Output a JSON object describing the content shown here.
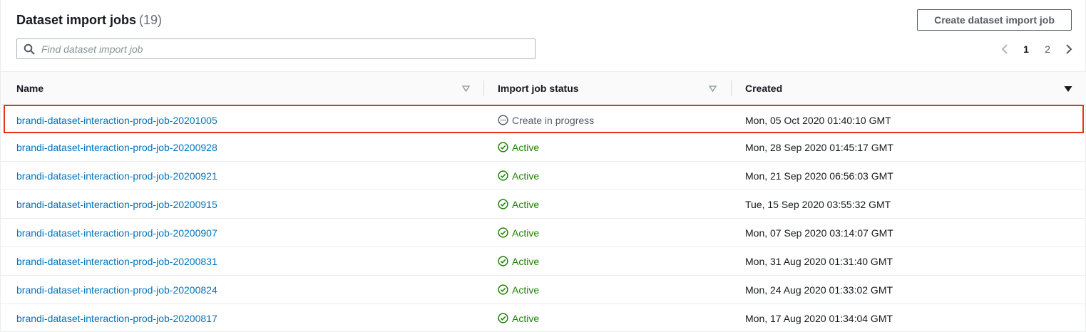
{
  "header": {
    "title": "Dataset import jobs",
    "count": "(19)",
    "create_button_label": "Create dataset import job"
  },
  "search": {
    "placeholder": "Find dataset import job",
    "value": ""
  },
  "pagination": {
    "pages": [
      "1",
      "2"
    ],
    "current_page": "1"
  },
  "table": {
    "columns": [
      "Name",
      "Import job status",
      "Created"
    ],
    "rows": [
      {
        "name": "brandi-dataset-interaction-prod-job-20201005",
        "status": "Create in progress",
        "created": "Mon, 05 Oct 2020 01:40:10 GMT"
      },
      {
        "name": "brandi-dataset-interaction-prod-job-20200928",
        "status": "Active",
        "created": "Mon, 28 Sep 2020 01:45:17 GMT"
      },
      {
        "name": "brandi-dataset-interaction-prod-job-20200921",
        "status": "Active",
        "created": "Mon, 21 Sep 2020 06:56:03 GMT"
      },
      {
        "name": "brandi-dataset-interaction-prod-job-20200915",
        "status": "Active",
        "created": "Tue, 15 Sep 2020 03:55:32 GMT"
      },
      {
        "name": "brandi-dataset-interaction-prod-job-20200907",
        "status": "Active",
        "created": "Mon, 07 Sep 2020 03:14:07 GMT"
      },
      {
        "name": "brandi-dataset-interaction-prod-job-20200831",
        "status": "Active",
        "created": "Mon, 31 Aug 2020 01:31:40 GMT"
      },
      {
        "name": "brandi-dataset-interaction-prod-job-20200824",
        "status": "Active",
        "created": "Mon, 24 Aug 2020 01:33:02 GMT"
      },
      {
        "name": "brandi-dataset-interaction-prod-job-20200817",
        "status": "Active",
        "created": "Mon, 17 Aug 2020 01:34:04 GMT"
      }
    ]
  },
  "colors": {
    "link": "#0073bb",
    "active": "#1d8102",
    "in_progress": "#545b64",
    "highlight": "#e8341c"
  },
  "icons": {
    "search": "search-icon",
    "active": "check-circle-icon",
    "in_progress": "ellipsis-circle-icon",
    "sort": "sort-triangle-icon",
    "prev": "chevron-left-icon",
    "next": "chevron-right-icon"
  }
}
